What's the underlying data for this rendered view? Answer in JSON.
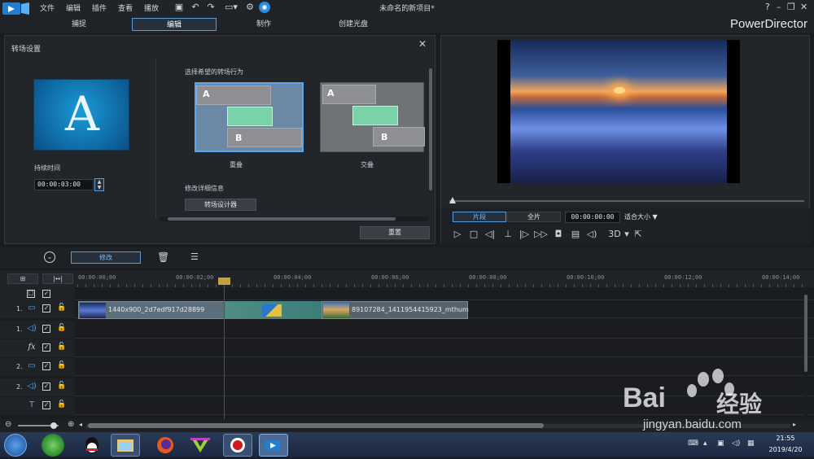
{
  "menu": [
    "文件",
    "编辑",
    "插件",
    "查看",
    "播放"
  ],
  "window_title": "未命名的新项目*",
  "brand": "PowerDirector",
  "tabs": [
    "捕捉",
    "编辑",
    "制作",
    "创建光盘"
  ],
  "active_tab": "编辑",
  "transition_panel": {
    "title": "转场设置",
    "preview_letter": "A",
    "duration_label": "持续时间",
    "duration_value": "00:00:03:00",
    "behavior_label": "选择希望的转场行为",
    "option_overlap": "重叠",
    "option_cross": "交叠",
    "card_a": "A",
    "card_b": "B",
    "detail_label": "修改详细信息",
    "designer_button": "转场设计器",
    "reset_button": "重置"
  },
  "preview": {
    "clip_button": "片段",
    "full_button": "全片",
    "timecode": "00:00:00:00",
    "fit_label": "适合大小 ▼",
    "three_d": "3D"
  },
  "toolbar": {
    "modify_button": "修改"
  },
  "ruler": [
    "00:00:00;00",
    "00:00:02;00",
    "00:00:04;00",
    "00:00:06;00",
    "00:00:08;00",
    "00:00:10;00",
    "00:00:12;00",
    "00:00:14;00"
  ],
  "tracks": [
    {
      "num": "",
      "icon": "☐"
    },
    {
      "num": "1.",
      "icon": "▭"
    },
    {
      "num": "1.",
      "icon": "◁)"
    },
    {
      "num": "",
      "icon": "fx"
    },
    {
      "num": "2.",
      "icon": "▭"
    },
    {
      "num": "2.",
      "icon": "◁)"
    },
    {
      "num": "",
      "icon": "T"
    }
  ],
  "clips": {
    "clip1": "1440x900_2d7edf917d28899",
    "clip2": "89107284_1411954415923_mthum"
  },
  "taskbar": {
    "time": "21:55",
    "date": "2019/4/20"
  },
  "watermark": {
    "logo": "Bai",
    "cn": "经验",
    "url": "jingyan.baidu.com"
  }
}
